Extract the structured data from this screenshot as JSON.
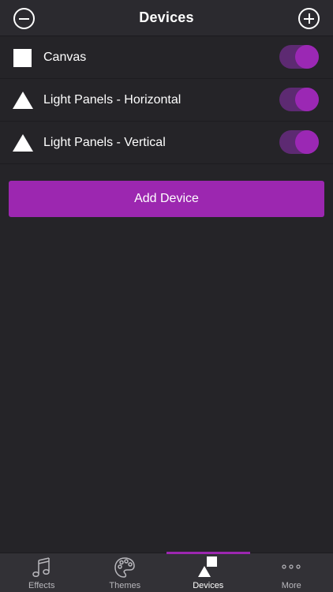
{
  "header": {
    "title": "Devices"
  },
  "devices": [
    {
      "label": "Canvas",
      "icon": "square-icon",
      "enabled": true
    },
    {
      "label": "Light Panels - Horizontal",
      "icon": "triangle-icon",
      "enabled": true
    },
    {
      "label": "Light Panels - Vertical",
      "icon": "triangle-icon",
      "enabled": true
    }
  ],
  "add_button": {
    "label": "Add Device"
  },
  "tabs": [
    {
      "label": "Effects",
      "icon": "music-note-icon"
    },
    {
      "label": "Themes",
      "icon": "palette-icon"
    },
    {
      "label": "Devices",
      "icon": "devices-icon",
      "active": true
    },
    {
      "label": "More",
      "icon": "more-dots-icon"
    }
  ],
  "colors": {
    "accent": "#9c27b0",
    "background": "#252428",
    "header": "#2b2a2f",
    "tabbar": "#323136"
  }
}
